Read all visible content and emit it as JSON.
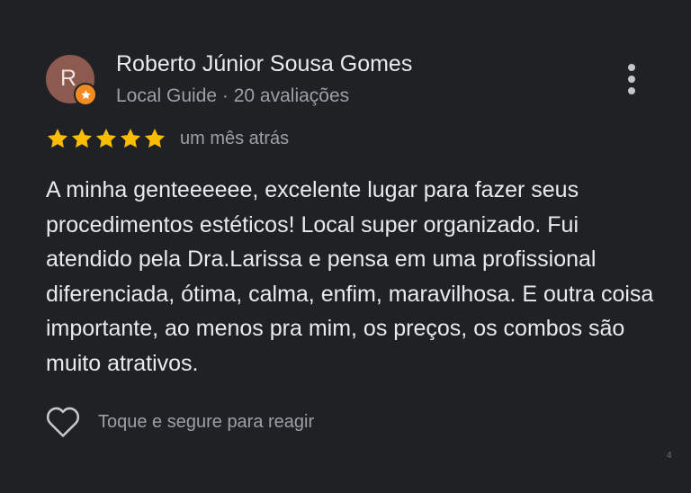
{
  "review": {
    "author": {
      "initial": "R",
      "name": "Roberto Júnior Sousa Gomes",
      "meta": "Local Guide · 20 avaliações",
      "avatar_color": "#8d5a4f",
      "badge_color": "#f28b22",
      "badge_icon": "star-icon"
    },
    "menu_icon": "more-vert-icon",
    "rating": {
      "stars": 5,
      "max": 5,
      "star_color": "#fbbc04"
    },
    "date": "um mês atrás",
    "text": "A minha genteeeeee, excelente lugar para fazer seus procedimentos estéticos! Local super organizado. Fui atendido pela Dra.Larissa e pensa em uma profissional diferenciada, ótima, calma, enfim, maravilhosa. E outra coisa importante, ao menos pra mim, os preços, os combos são muito atrativos.",
    "react": {
      "icon": "heart-outline-icon",
      "label": "Toque e segure para reagir"
    }
  },
  "page_marker": "4",
  "colors": {
    "background": "#202124",
    "primary_text": "#e8eaed",
    "secondary_text": "#9aa0a6"
  }
}
